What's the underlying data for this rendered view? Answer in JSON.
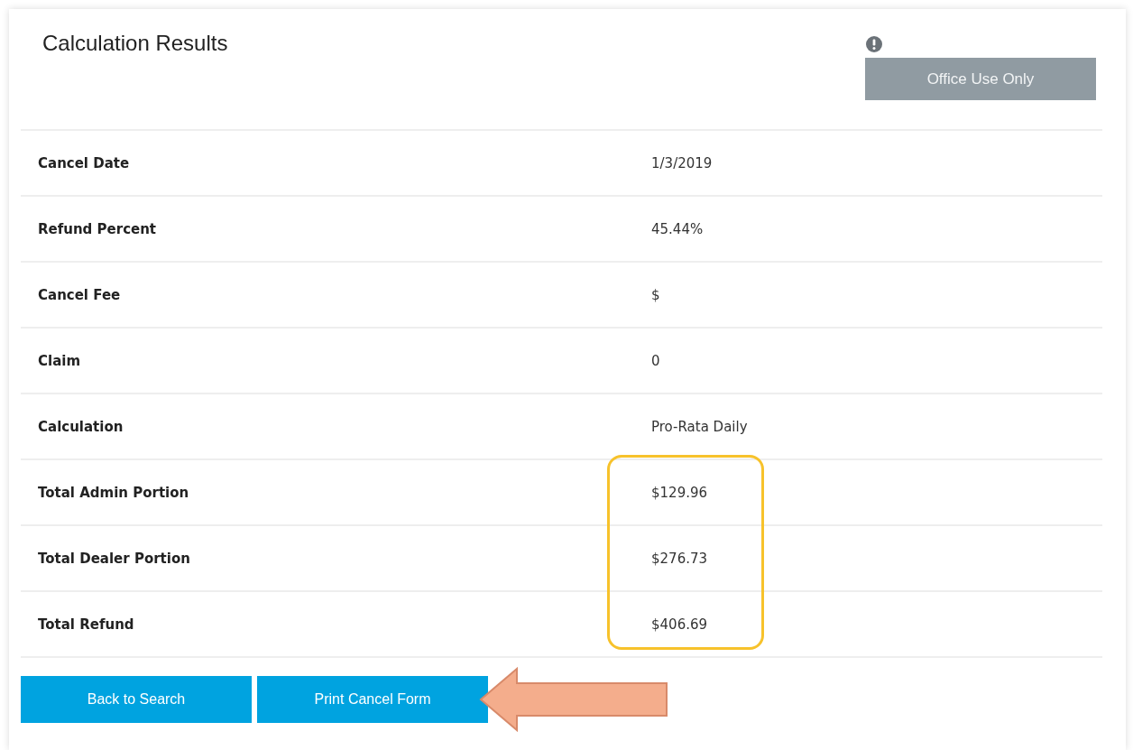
{
  "title": "Calculation Results",
  "office_button": {
    "label": "Office Use Only",
    "disabled": true
  },
  "rows": [
    {
      "label": "Cancel Date",
      "value": "1/3/2019",
      "highlighted": false
    },
    {
      "label": "Refund Percent",
      "value": "45.44%",
      "highlighted": false
    },
    {
      "label": "Cancel Fee",
      "value": "$",
      "highlighted": false
    },
    {
      "label": "Claim",
      "value": "0",
      "highlighted": false
    },
    {
      "label": "Calculation",
      "value": "Pro-Rata Daily",
      "highlighted": false
    },
    {
      "label": "Total Admin Portion",
      "value": "$129.96",
      "highlighted": true
    },
    {
      "label": "Total Dealer Portion",
      "value": "$276.73",
      "highlighted": true
    },
    {
      "label": "Total Refund",
      "value": "$406.69",
      "highlighted": true
    }
  ],
  "buttons": [
    {
      "label": "Back to Search",
      "pointed_at": false
    },
    {
      "label": "Print Cancel Form",
      "pointed_at": true
    }
  ]
}
